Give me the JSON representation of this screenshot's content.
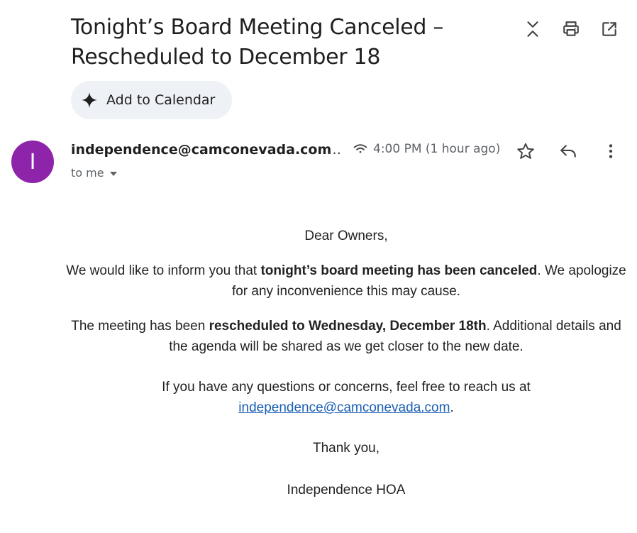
{
  "email": {
    "subject_line1": "Tonight’s Board Meeting Canceled –",
    "subject_line2": "Rescheduled to December 18",
    "add_to_calendar_label": "Add to Calendar",
    "avatar_letter": "I",
    "sender": "independence@camconevada.com",
    "sender_ellipsis": "…",
    "recipient_label": "to me",
    "time": "4:00 PM (1 hour ago)"
  },
  "icons": {
    "collapse": "collapse-icon",
    "print": "print-icon",
    "open_new_window": "open-in-new-icon",
    "sparkle": "sparkle-icon",
    "signal": "signal-icon",
    "star": "star-icon",
    "reply": "reply-icon",
    "more": "more-vert-icon"
  },
  "body": {
    "greeting": "Dear Owners,",
    "p1_pre": "We would like to inform you that ",
    "p1_bold": "tonight’s board meeting has been canceled",
    "p1_post": ". We apologize for any inconvenience this may cause.",
    "p2_pre": "The meeting has been ",
    "p2_bold": "rescheduled to Wednesday, December 18th",
    "p2_post": ". Additional details and the agenda will be shared as we get closer to the new date.",
    "p3_pre": "If you have any questions or concerns, feel free to reach us at ",
    "p3_link": "independence@camconevada.com",
    "p3_post": ".",
    "thanks": "Thank you,",
    "signature": "Independence HOA"
  },
  "colors": {
    "avatar_bg": "#8e24aa",
    "calendar_button_bg": "#eef1f6",
    "link": "#1a5fb4"
  }
}
